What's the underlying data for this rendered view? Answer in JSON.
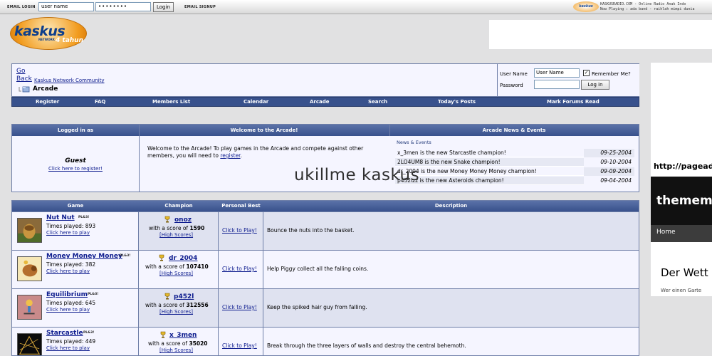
{
  "topbar": {
    "email_login_label": "EMAIL LOGIN",
    "username_value": "user name",
    "password_value": "••••••••",
    "login_button": "Login",
    "email_signup_label": "EMAIL SIGNUP",
    "radio_logo_text": "kaskus",
    "radio_line1": "KASKUSRADIO.COM - Online Radio Anak Indo",
    "radio_line2": "Now Playing : ada band - raihlah mimpi dunia"
  },
  "logo": {
    "word": "kaskus",
    "network": "NETWORK",
    "tahun": "4 tahun"
  },
  "nav": {
    "go": "Go",
    "back": "Back",
    "community": "Kaskus Network Community",
    "current": "Arcade",
    "login": {
      "username_label": "User Name",
      "username_value": "User Name",
      "remember_label": "Remember Me?",
      "remember_checked": "✓",
      "password_label": "Password",
      "login_button": "Log in"
    }
  },
  "navbar": [
    "Register",
    "FAQ",
    "Members List",
    "Calendar",
    "Arcade",
    "Search",
    "Today's Posts",
    "Mark Forums Read"
  ],
  "welcome": {
    "head_logged": "Logged in as",
    "head_welcome": "Welcome to the Arcade!",
    "head_news": "Arcade News & Events",
    "guest": "Guest",
    "register_link": "Click here to register!",
    "message": "Welcome to the Arcade! To play games in the Arcade and compete against other members, you will need to",
    "message_link": "register",
    "message_end": ".",
    "news_title": "News & Events",
    "news": [
      {
        "text": "x_3men is the new Starcastle champion!",
        "date": "09-25-2004"
      },
      {
        "text": "2LO4UM8 is the new Snake champion!",
        "date": "09-10-2004"
      },
      {
        "text": "dr_2004 is the new Money Money Money champion!",
        "date": "09-09-2004"
      },
      {
        "text": "p452lzz is the new Asteroids champion!",
        "date": "09-04-2004"
      }
    ]
  },
  "watermark": "ukillme kaskus",
  "games": {
    "headers": [
      "Game",
      "Champion",
      "Personal Best",
      "Description"
    ],
    "play_label": "Click here to play",
    "with_score": "with a score of",
    "high_scores": "[High Scores]",
    "click_to_play": "Click to Play!",
    "pl_tag": "PL&3!",
    "rows": [
      {
        "name": "Nut Nut",
        "played": "Times played: 893",
        "champion": "onoz",
        "score": "1590",
        "description": "Bounce the nuts into the basket."
      },
      {
        "name": "Money Money Money",
        "played": "Times played: 382",
        "champion": "dr_2004",
        "score": "107410",
        "description": "Help Piggy collect all the falling coins."
      },
      {
        "name": "Equilibrium",
        "played": "Times played: 645",
        "champion": "p452l",
        "score": "312556",
        "description": "Keep the spiked hair guy from falling."
      },
      {
        "name": "Starcastle",
        "played": "Times played: 449",
        "champion": "x_3men",
        "score": "35020",
        "description": "Break through the three layers of walls and destroy the central behemoth."
      }
    ]
  },
  "ad_right": {
    "url": "http://pagead",
    "brand": "thememe",
    "home": "Home",
    "der": "Der Wett",
    "wer": "Wer einen Garte"
  }
}
